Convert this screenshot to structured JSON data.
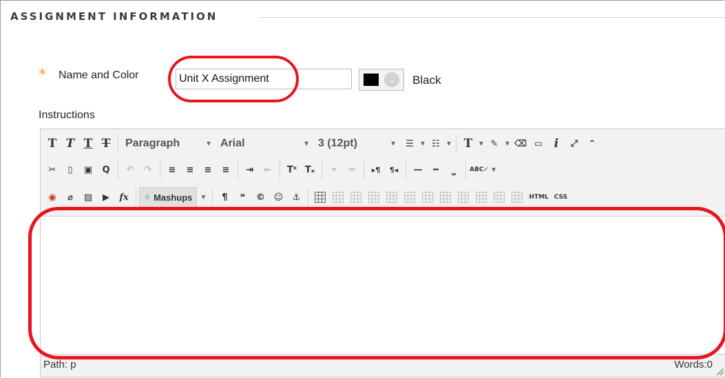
{
  "section": {
    "title": "ASSIGNMENT INFORMATION"
  },
  "name_field": {
    "required_marker": "*",
    "label": "Name and Color",
    "value": "Unit X Assignment"
  },
  "color_picker": {
    "swatch_color": "#000000",
    "color_name": "Black",
    "dropdown_glyph": "⌄"
  },
  "instructions": {
    "label": "Instructions"
  },
  "toolbar": {
    "row1": {
      "bold": "T",
      "italic": "T",
      "underline": "T",
      "strikethrough": "T",
      "format_select": "Paragraph",
      "font_select": "Arial",
      "size_select": "3 (12pt)",
      "bullet_list": "☰",
      "numbered_list": "☷",
      "text_color": "T",
      "highlight": "✎",
      "eraser": "⌫",
      "preview": "▭",
      "info": "i",
      "fullscreen": "⤢",
      "collapse": "⌃"
    },
    "row2": {
      "cut": "✂",
      "new_doc": "▯",
      "paste": "▣",
      "find": "Q",
      "undo": "↶",
      "redo": "↷",
      "align_left": "≡",
      "align_center": "≡",
      "align_right": "≡",
      "justify": "≡",
      "indent": "⇥",
      "outdent": "⇤",
      "superscript": "Tˣ",
      "subscript": "Tₓ",
      "link": "⚭",
      "unlink": "⚮",
      "ltr": "▸¶",
      "rtl": "¶◂",
      "hr": "—",
      "hr_thick": "━",
      "nbsp": "⎵",
      "spellcheck": "ABC✓"
    },
    "row3": {
      "record": "◉",
      "attach": "⌀",
      "image": "▨",
      "media": "▶",
      "formula": "fx",
      "mashups_label": "Mashups",
      "mashups_dots": "⁘",
      "pilcrow": "¶",
      "quote": "❝",
      "copyright": "©",
      "emoticon": "☺",
      "anchor": "⚓",
      "html": "HTML",
      "css": "CSS"
    }
  },
  "status_bar": {
    "path": "Path: p",
    "words": "Words:0"
  }
}
